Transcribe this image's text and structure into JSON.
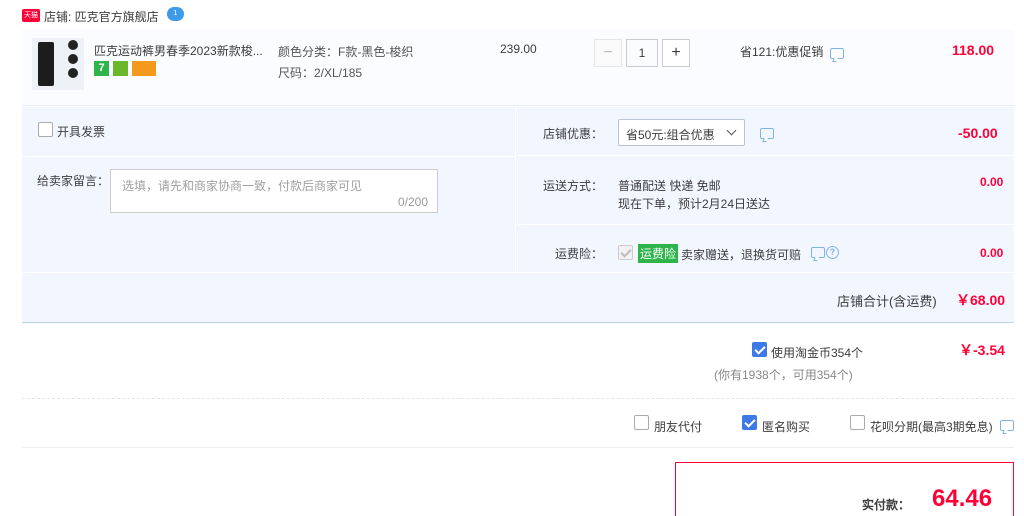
{
  "shop": {
    "badge": "天猫",
    "label": "店铺: 匹克官方旗舰店",
    "chat_badge": "1"
  },
  "item": {
    "title": "匹克运动裤男春季2023新款梭...",
    "color": "颜色分类：F款-黑色-梭织",
    "size": "尺码：2/XL/185",
    "unit_price": "239.00",
    "quantity": "1",
    "minus": "−",
    "plus": "+",
    "promo": "省121:优惠促销",
    "total": "118.00",
    "tag_seven": "7"
  },
  "invoice": {
    "label": "开具发票"
  },
  "message": {
    "label": "给卖家留言：",
    "placeholder": "选填，请先和商家协商一致，付款后商家可见",
    "count": "0/200"
  },
  "shop_discount": {
    "label": "店铺优惠：",
    "selected": "省50元:组合优惠",
    "amount": "-50.00"
  },
  "delivery": {
    "label": "运送方式：",
    "method": "普通配送 快递 免邮",
    "eta": "现在下单，预计2月24日送达",
    "amount": "0.00"
  },
  "insurance": {
    "label": "运费险：",
    "tag": "运费险",
    "desc": "卖家赠送，退换货可赔",
    "amount": "0.00"
  },
  "shop_total": {
    "label": "店铺合计(含运费)",
    "amount": "￥68.00"
  },
  "coins": {
    "label": "使用淘金币354个",
    "note": "(你有1938个，可用354个)",
    "amount": "￥-3.54"
  },
  "options": {
    "friend_pay": "朋友代付",
    "anonymous": "匿名购买",
    "installment": "花呗分期(最高3期免息)"
  },
  "payment": {
    "label": "实付款：",
    "amount": "64.46"
  },
  "colors": {
    "accent": "#ff0036",
    "blue": "#3e7ae6",
    "section_bg": "#f2f7ff"
  }
}
